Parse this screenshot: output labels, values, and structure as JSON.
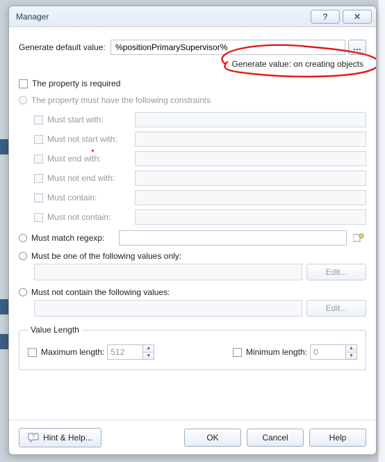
{
  "window": {
    "title": "Manager"
  },
  "titlebar_buttons": {
    "help_glyph": "?",
    "close_glyph": "✕"
  },
  "generate_default": {
    "label": "Generate default value:",
    "value": "%positionPrimarySupervisor%",
    "browse_glyph": "…",
    "note": "Generate value: on creating objects"
  },
  "required": {
    "label": "The property is required"
  },
  "constraints": {
    "label": "The property must have the following constraints",
    "must_start_with": "Must start with:",
    "must_not_start_with": "Must not start with:",
    "must_end_with": "Must end with:",
    "must_not_end_with": "Must not end with:",
    "must_contain": "Must contain:",
    "must_not_contain": "Must not contain:"
  },
  "regexp": {
    "label": "Must match regexp:"
  },
  "one_of": {
    "label": "Must be one of the following values only:",
    "edit": "Edit..."
  },
  "not_contain_vals": {
    "label": "Must not contain the following values:",
    "edit": "Edit..."
  },
  "value_length": {
    "legend": "Value Length",
    "max_label": "Maximum length:",
    "max_value": "512",
    "min_label": "Minimum length:",
    "min_value": "0"
  },
  "footer": {
    "hint": "Hint & Help...",
    "ok": "OK",
    "cancel": "Cancel",
    "help": "Help"
  }
}
